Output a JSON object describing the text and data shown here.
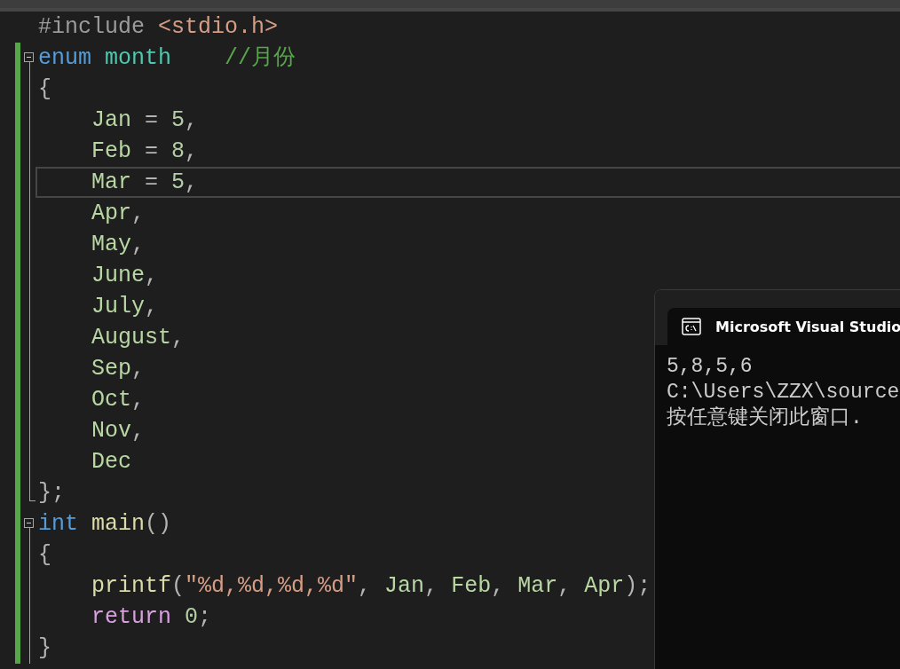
{
  "editor": {
    "lines": [
      {
        "changed": false,
        "kind": "plain",
        "current": false,
        "tokens": [
          {
            "kind": "preproc",
            "text": "#include "
          },
          {
            "kind": "include-path",
            "text": "<stdio.h>"
          }
        ]
      },
      {
        "changed": true,
        "kind": "fold",
        "current": false,
        "tokens": [
          {
            "kind": "keyword",
            "text": "enum "
          },
          {
            "kind": "type",
            "text": "month"
          },
          {
            "kind": "comment",
            "text": "    //月份"
          }
        ]
      },
      {
        "changed": true,
        "kind": "body",
        "current": false,
        "tokens": [
          {
            "kind": "punct",
            "text": "{"
          }
        ]
      },
      {
        "changed": true,
        "kind": "body",
        "current": false,
        "tokens": [
          {
            "kind": "enumerator",
            "text": "    Jan"
          },
          {
            "kind": "punct",
            "text": " = "
          },
          {
            "kind": "number",
            "text": "5"
          },
          {
            "kind": "punct",
            "text": ","
          }
        ]
      },
      {
        "changed": true,
        "kind": "body",
        "current": false,
        "tokens": [
          {
            "kind": "enumerator",
            "text": "    Feb"
          },
          {
            "kind": "punct",
            "text": " = "
          },
          {
            "kind": "number",
            "text": "8"
          },
          {
            "kind": "punct",
            "text": ","
          }
        ]
      },
      {
        "changed": true,
        "kind": "body",
        "current": true,
        "tokens": [
          {
            "kind": "enumerator",
            "text": "    Mar"
          },
          {
            "kind": "punct",
            "text": " = "
          },
          {
            "kind": "number",
            "text": "5"
          },
          {
            "kind": "punct",
            "text": ","
          }
        ]
      },
      {
        "changed": true,
        "kind": "body",
        "current": false,
        "tokens": [
          {
            "kind": "enumerator",
            "text": "    Apr"
          },
          {
            "kind": "punct",
            "text": ","
          }
        ]
      },
      {
        "changed": true,
        "kind": "body",
        "current": false,
        "tokens": [
          {
            "kind": "enumerator",
            "text": "    May"
          },
          {
            "kind": "punct",
            "text": ","
          }
        ]
      },
      {
        "changed": true,
        "kind": "body",
        "current": false,
        "tokens": [
          {
            "kind": "enumerator",
            "text": "    June"
          },
          {
            "kind": "punct",
            "text": ","
          }
        ]
      },
      {
        "changed": true,
        "kind": "body",
        "current": false,
        "tokens": [
          {
            "kind": "enumerator",
            "text": "    July"
          },
          {
            "kind": "punct",
            "text": ","
          }
        ]
      },
      {
        "changed": true,
        "kind": "body",
        "current": false,
        "tokens": [
          {
            "kind": "enumerator",
            "text": "    August"
          },
          {
            "kind": "punct",
            "text": ","
          }
        ]
      },
      {
        "changed": true,
        "kind": "body",
        "current": false,
        "tokens": [
          {
            "kind": "enumerator",
            "text": "    Sep"
          },
          {
            "kind": "punct",
            "text": ","
          }
        ]
      },
      {
        "changed": true,
        "kind": "body",
        "current": false,
        "tokens": [
          {
            "kind": "enumerator",
            "text": "    Oct"
          },
          {
            "kind": "punct",
            "text": ","
          }
        ]
      },
      {
        "changed": true,
        "kind": "body",
        "current": false,
        "tokens": [
          {
            "kind": "enumerator",
            "text": "    Nov"
          },
          {
            "kind": "punct",
            "text": ","
          }
        ]
      },
      {
        "changed": true,
        "kind": "body",
        "current": false,
        "tokens": [
          {
            "kind": "enumerator",
            "text": "    Dec"
          }
        ]
      },
      {
        "changed": true,
        "kind": "end",
        "current": false,
        "tokens": [
          {
            "kind": "punct",
            "text": "};"
          }
        ]
      },
      {
        "changed": true,
        "kind": "fold",
        "current": false,
        "tokens": [
          {
            "kind": "keyword",
            "text": "int "
          },
          {
            "kind": "function",
            "text": "main"
          },
          {
            "kind": "punct",
            "text": "()"
          }
        ]
      },
      {
        "changed": true,
        "kind": "body",
        "current": false,
        "tokens": [
          {
            "kind": "punct",
            "text": "{"
          }
        ]
      },
      {
        "changed": true,
        "kind": "body",
        "current": false,
        "tokens": [
          {
            "kind": "function",
            "text": "    printf"
          },
          {
            "kind": "punct",
            "text": "("
          },
          {
            "kind": "string",
            "text": "\"%d,%d,%d,%d\""
          },
          {
            "kind": "punct",
            "text": ", "
          },
          {
            "kind": "enumerator",
            "text": "Jan"
          },
          {
            "kind": "punct",
            "text": ", "
          },
          {
            "kind": "enumerator",
            "text": "Feb"
          },
          {
            "kind": "punct",
            "text": ", "
          },
          {
            "kind": "enumerator",
            "text": "Mar"
          },
          {
            "kind": "punct",
            "text": ", "
          },
          {
            "kind": "enumerator",
            "text": "Apr"
          },
          {
            "kind": "punct",
            "text": ");"
          }
        ]
      },
      {
        "changed": true,
        "kind": "body",
        "current": false,
        "tokens": [
          {
            "kind": "control",
            "text": "    return "
          },
          {
            "kind": "number",
            "text": "0"
          },
          {
            "kind": "punct",
            "text": ";"
          }
        ]
      },
      {
        "changed": true,
        "kind": "body",
        "current": false,
        "tokens": [
          {
            "kind": "punct",
            "text": "}"
          }
        ]
      }
    ]
  },
  "console": {
    "title": "Microsoft Visual Studio",
    "lines": [
      "5,8,5,6",
      "C:\\Users\\ZZX\\source",
      "按任意键关闭此窗口."
    ]
  }
}
